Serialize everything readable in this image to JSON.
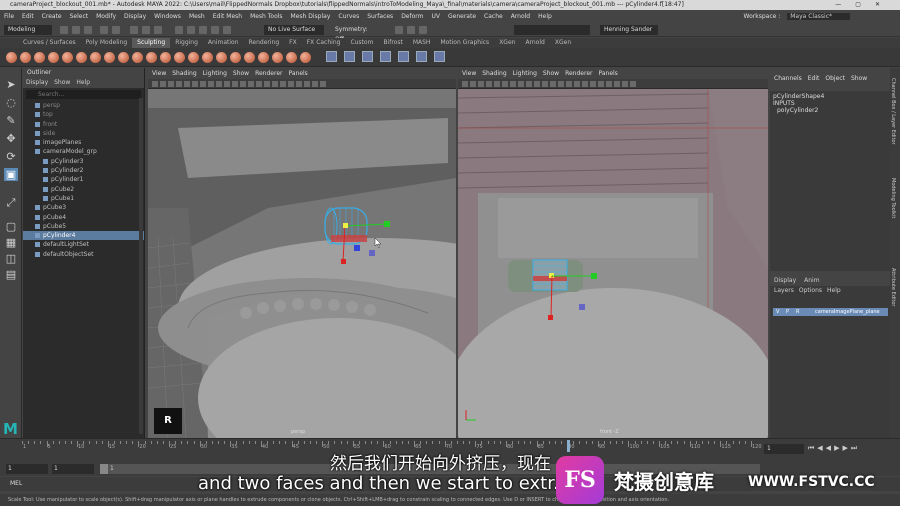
{
  "title_bar": {
    "text": "cameraProject_blockout_001.mb* - Autodesk MAYA 2022: C:\\Users\\mail\\FlippedNormals Dropbox\\tutorials\\flippedNormals\\introToModeling_Maya\\_final\\materials\\camera\\cameraProject_blockout_001.mb  ---  pCylinder4.f[18:47]"
  },
  "menu": [
    "File",
    "Edit",
    "Create",
    "Select",
    "Modify",
    "Display",
    "Windows",
    "Mesh",
    "Edit Mesh",
    "Mesh Tools",
    "Mesh Display",
    "Curves",
    "Surfaces",
    "Deform",
    "UV",
    "Generate",
    "Cache",
    "Arnold",
    "Help"
  ],
  "workspace": {
    "label": "Workspace :",
    "value": "Maya Classic*"
  },
  "status_line": {
    "menuset": "Modeling",
    "surface": "No Live Surface",
    "symmetry": "Symmetry: Off",
    "user": "Henning Sander"
  },
  "shelf_tabs": [
    "Curves / Surfaces",
    "Poly Modeling",
    "Sculpting",
    "Rigging",
    "Animation",
    "Rendering",
    "FX",
    "FX Caching",
    "Custom",
    "Bifrost",
    "MASH",
    "Motion Graphics",
    "XGen",
    "Arnold",
    "XGen"
  ],
  "shelf_active": "Sculpting",
  "outliner": {
    "title": "Outliner",
    "menu": [
      "Display",
      "Show",
      "Help"
    ],
    "search_placeholder": "Search...",
    "items": [
      {
        "label": "persp",
        "indent": 1,
        "dim": true
      },
      {
        "label": "top",
        "indent": 1,
        "dim": true
      },
      {
        "label": "front",
        "indent": 1,
        "dim": true
      },
      {
        "label": "side",
        "indent": 1,
        "dim": true
      },
      {
        "label": "imagePlanes",
        "indent": 1
      },
      {
        "label": "cameraModel_grp",
        "indent": 1
      },
      {
        "label": "pCylinder3",
        "indent": 2
      },
      {
        "label": "pCylinder2",
        "indent": 2
      },
      {
        "label": "pCylinder1",
        "indent": 2
      },
      {
        "label": "pCube2",
        "indent": 2
      },
      {
        "label": "pCube1",
        "indent": 2
      },
      {
        "label": "pCube3",
        "indent": 1
      },
      {
        "label": "pCube4",
        "indent": 1
      },
      {
        "label": "pCube5",
        "indent": 1
      },
      {
        "label": "pCylinder4",
        "indent": 1,
        "selected": true
      },
      {
        "label": "defaultLightSet",
        "indent": 1
      },
      {
        "label": "defaultObjectSet",
        "indent": 1
      }
    ]
  },
  "viewport_menu": [
    "View",
    "Shading",
    "Lighting",
    "Show",
    "Renderer",
    "Panels"
  ],
  "viewport_left": {
    "camera": "persp",
    "key_hint": "R"
  },
  "viewport_right": {
    "camera": "front -Z"
  },
  "channel_box": {
    "menu": [
      "Channels",
      "Edit",
      "Object",
      "Show"
    ],
    "shape": "pCylinderShape4",
    "inputs_label": "INPUTS",
    "input": "polyCylinder2"
  },
  "layer_editor": {
    "tabs": [
      "Display",
      "Anim"
    ],
    "menu": [
      "Layers",
      "Options",
      "Help"
    ],
    "layer": {
      "v": "V",
      "p": "P",
      "r": "R",
      "name": "cameraImagePlane_plane"
    }
  },
  "side_tabs": [
    "Channel Box / Layer Editor",
    "Modeling Toolkit",
    "Attribute Editor"
  ],
  "timeline": {
    "ticks": [
      1,
      5,
      10,
      15,
      20,
      25,
      30,
      35,
      40,
      45,
      50,
      55,
      60,
      65,
      70,
      75,
      80,
      85,
      90,
      95,
      100,
      105,
      110,
      115,
      120
    ],
    "current_frame_box": "1",
    "playhead_frame": 90,
    "range_fields": [
      "1",
      "1",
      "1"
    ],
    "slider_label": "1"
  },
  "mel_label": "MEL",
  "help_line": "Scale Tool: Use manipulator to scale object(s). Shift+drag manipulator axis or plane handles to extrude components or clone objects. Ctrl+Shift+LMB+drag to constrain scaling to connected edges. Use D or INSERT to change the pivot position and axis orientation.",
  "subtitles": {
    "chinese": "然后我们开始向外挤压，现在",
    "english": "and two faces and then we start to extr..."
  },
  "watermark": {
    "logo": "FS",
    "chinese": "梵摄创意库",
    "url": "WWW.FSTVC.CC"
  },
  "colors": {
    "selection_blue": "#5b7b9f",
    "manip_green": "#22cc22",
    "manip_red": "#dd2222",
    "manip_blue": "#3344dd",
    "maya_teal": "#25b5b5"
  }
}
